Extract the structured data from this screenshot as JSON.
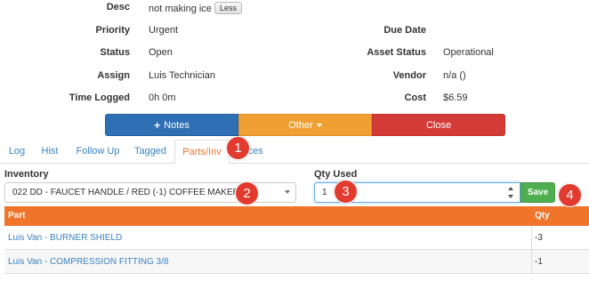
{
  "details": {
    "desc_label": "Desc",
    "desc_value": "not making ice",
    "less_label": "Less",
    "priority_label": "Priority",
    "priority_value": "Urgent",
    "due_date_label": "Due Date",
    "due_date_value": "",
    "status_label": "Status",
    "status_value": "Open",
    "asset_status_label": "Asset Status",
    "asset_status_value": "Operational",
    "assign_label": "Assign",
    "assign_value": "Luis Technician",
    "vendor_label": "Vendor",
    "vendor_value": "n/a ()",
    "time_logged_label": "Time Logged",
    "time_logged_value": "0h 0m",
    "cost_label": "Cost",
    "cost_value": "$6.59"
  },
  "actions": {
    "notes_label": "Notes",
    "other_label": "Other",
    "close_label": "Close"
  },
  "tabs": [
    {
      "label": "Log",
      "active": false
    },
    {
      "label": "Hist",
      "active": false
    },
    {
      "label": "Follow Up",
      "active": false
    },
    {
      "label": "Tagged",
      "active": false
    },
    {
      "label": "Parts/Inv",
      "active": true
    },
    {
      "label": "oices",
      "active": false
    }
  ],
  "form": {
    "inventory_label": "Inventory",
    "inventory_selected": "022 DD - FAUCET HANDLE / RED (-1) COFFEE MAKER",
    "qty_label": "Qty Used",
    "qty_value": "1",
    "save_label": "Save"
  },
  "table": {
    "headers": {
      "part": "Part",
      "qty": "Qty"
    },
    "rows": [
      {
        "part": "Luis Van - BURNER SHIELD",
        "qty": "-3"
      },
      {
        "part": "Luis Van - COMPRESSION FITTING 3/8",
        "qty": "-1"
      }
    ]
  },
  "badges": [
    "1",
    "2",
    "3",
    "4"
  ],
  "colors": {
    "notes": "#2f6fb4",
    "other": "#f0a033",
    "close": "#d43b36",
    "save": "#4fae4f",
    "table_header": "#f0742a",
    "active_tab": "#f0742a",
    "link": "#3a82c4",
    "badge": "#e23a2e"
  }
}
